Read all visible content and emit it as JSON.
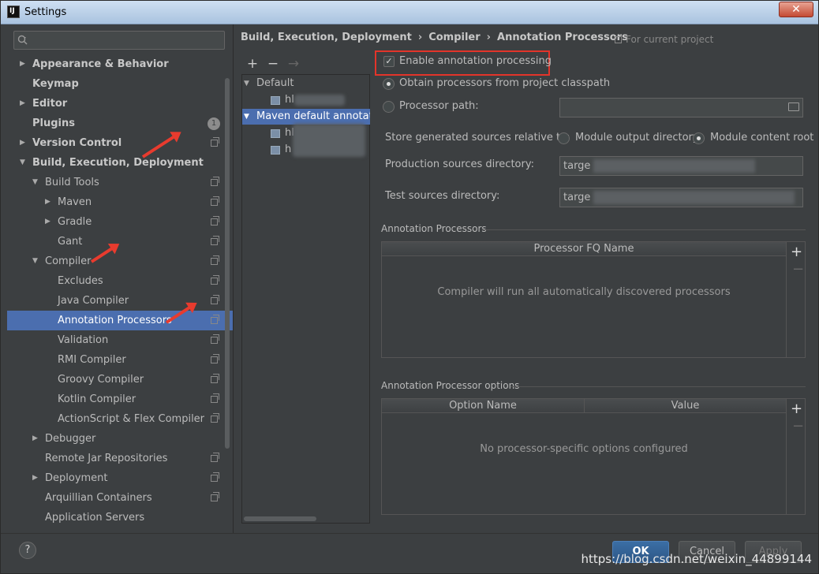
{
  "window": {
    "title": "Settings",
    "close_label": "✕",
    "app_icon_label": "IJ"
  },
  "search": {
    "placeholder": "",
    "icon": "search-icon"
  },
  "sidebar": {
    "items": [
      {
        "label": "Appearance & Behavior",
        "level": 0,
        "expandable": true,
        "expanded": false,
        "bold": true
      },
      {
        "label": "Keymap",
        "level": 0,
        "expandable": false,
        "bold": true
      },
      {
        "label": "Editor",
        "level": 0,
        "expandable": true,
        "expanded": false,
        "bold": true
      },
      {
        "label": "Plugins",
        "level": 0,
        "expandable": false,
        "bold": true,
        "badge": "1"
      },
      {
        "label": "Version Control",
        "level": 0,
        "expandable": true,
        "expanded": false,
        "bold": true,
        "project_icon": true
      },
      {
        "label": "Build, Execution, Deployment",
        "level": 0,
        "expandable": true,
        "expanded": true,
        "bold": true
      },
      {
        "label": "Build Tools",
        "level": 1,
        "expandable": true,
        "expanded": true,
        "project_icon": true
      },
      {
        "label": "Maven",
        "level": 2,
        "expandable": true,
        "expanded": false,
        "project_icon": true
      },
      {
        "label": "Gradle",
        "level": 2,
        "expandable": true,
        "expanded": false,
        "project_icon": true
      },
      {
        "label": "Gant",
        "level": 2,
        "expandable": false,
        "project_icon": true
      },
      {
        "label": "Compiler",
        "level": 1,
        "expandable": true,
        "expanded": true,
        "project_icon": true
      },
      {
        "label": "Excludes",
        "level": 2,
        "expandable": false,
        "project_icon": true
      },
      {
        "label": "Java Compiler",
        "level": 2,
        "expandable": false,
        "project_icon": true
      },
      {
        "label": "Annotation Processors",
        "level": 2,
        "expandable": false,
        "project_icon": true,
        "selected": true
      },
      {
        "label": "Validation",
        "level": 2,
        "expandable": false,
        "project_icon": true
      },
      {
        "label": "RMI Compiler",
        "level": 2,
        "expandable": false,
        "project_icon": true
      },
      {
        "label": "Groovy Compiler",
        "level": 2,
        "expandable": false,
        "project_icon": true
      },
      {
        "label": "Kotlin Compiler",
        "level": 2,
        "expandable": false,
        "project_icon": true
      },
      {
        "label": "ActionScript & Flex Compiler",
        "level": 2,
        "expandable": false,
        "project_icon": true
      },
      {
        "label": "Debugger",
        "level": 1,
        "expandable": true,
        "expanded": false
      },
      {
        "label": "Remote Jar Repositories",
        "level": 1,
        "expandable": false,
        "project_icon": true
      },
      {
        "label": "Deployment",
        "level": 1,
        "expandable": true,
        "expanded": false,
        "project_icon": true
      },
      {
        "label": "Arquillian Containers",
        "level": 1,
        "expandable": false,
        "project_icon": true
      },
      {
        "label": "Application Servers",
        "level": 1,
        "expandable": false
      }
    ]
  },
  "breadcrumb": {
    "part1": "Build, Execution, Deployment",
    "part2": "Compiler",
    "part3": "Annotation Processors",
    "sep": "›"
  },
  "scope_label": "For current project",
  "profiles": {
    "toolbar": {
      "add": "+",
      "remove": "−",
      "move": "→"
    },
    "items": [
      {
        "label": "Default",
        "type": "group"
      },
      {
        "label": "hl",
        "type": "module"
      },
      {
        "label": "Maven default annotation",
        "type": "group",
        "selected": true
      },
      {
        "label": "hl",
        "type": "module"
      },
      {
        "label": "h",
        "type": "module"
      }
    ]
  },
  "options": {
    "enable_label": "Enable annotation processing",
    "enable_checked": true,
    "obtain_label": "Obtain processors from project classpath",
    "processor_path_label": "Processor path:",
    "processor_path_value": "",
    "store_label": "Store generated sources relative to:",
    "module_output_label": "Module output directory",
    "module_content_label": "Module content root",
    "production_label": "Production sources directory:",
    "production_value": "targe",
    "test_label": "Test sources directory:",
    "test_value": "targe"
  },
  "processors_table": {
    "title": "Annotation Processors",
    "column": "Processor FQ Name",
    "empty": "Compiler will run all automatically discovered processors",
    "add": "+",
    "remove": "−"
  },
  "options_table": {
    "title": "Annotation Processor options",
    "col_name": "Option Name",
    "col_value": "Value",
    "empty": "No processor-specific options configured",
    "add": "+",
    "remove": "−"
  },
  "footer": {
    "help": "?",
    "ok": "OK",
    "cancel": "Cancel",
    "apply": "Apply"
  },
  "watermark": "https://blog.csdn.net/weixin_44899144",
  "colors": {
    "selection": "#4b6eaf",
    "highlight_border": "#e3342a",
    "arrow": "#e83b2e"
  }
}
